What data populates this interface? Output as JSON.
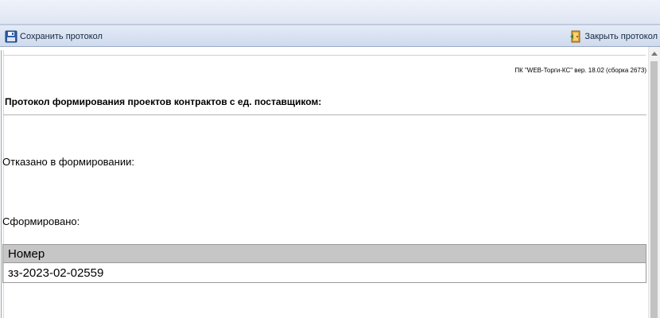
{
  "toolbar": {
    "save_label": "Сохранить протокол",
    "close_label": "Закрыть протокол",
    "save_icon": "floppy-disk-icon",
    "close_icon": "door-exit-icon"
  },
  "document": {
    "version": "ПК \"WEB-Торги-КС\" вер. 18.02 (сборка 2673)",
    "title": "Протокол формирования проектов контрактов с ед. поставщиком:",
    "refused_label": "Отказано в формировании:",
    "formed_label": "Сформировано:",
    "table": {
      "header": "Номер",
      "rows": [
        "зз-2023-02-02559"
      ]
    }
  }
}
